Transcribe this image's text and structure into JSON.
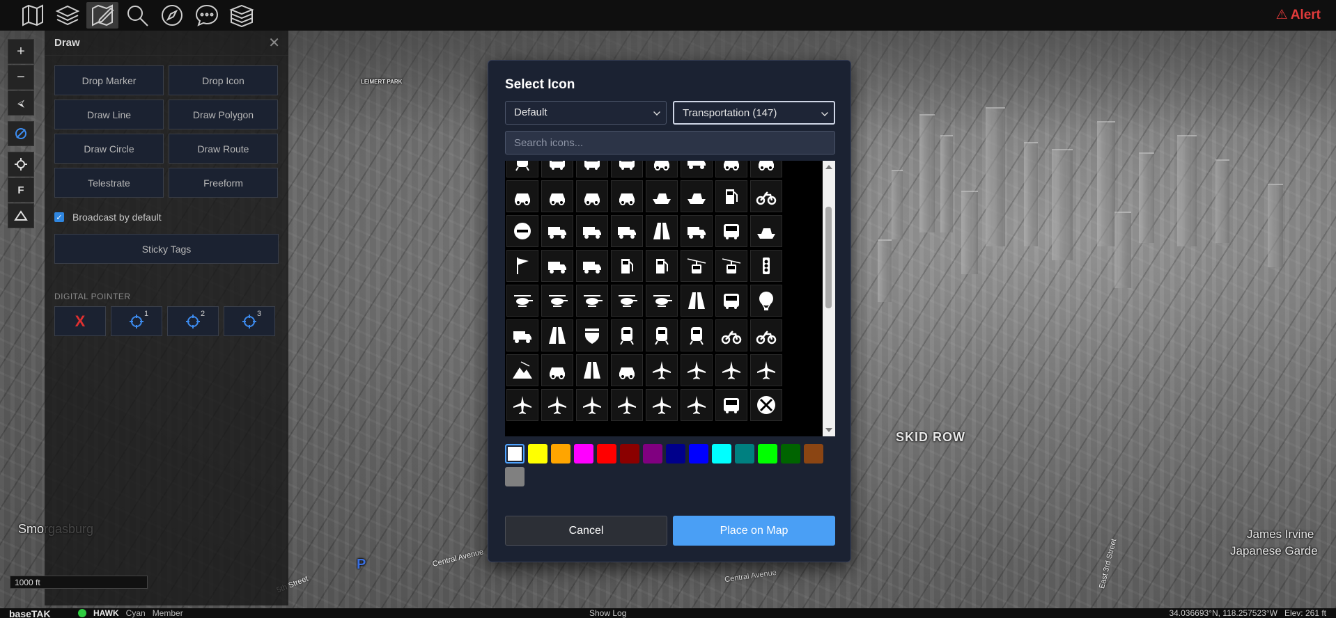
{
  "topbar": {
    "tools": [
      "map-icon",
      "layers-icon",
      "draw-icon",
      "search-icon",
      "compass-icon",
      "chat-icon",
      "data-package-icon"
    ],
    "alert_label": "Alert",
    "alert_color": "#e23b3b"
  },
  "map_controls": [
    "zoom-in",
    "zoom-out",
    "north-arrow",
    "hide-icon",
    "locate-icon",
    "F",
    "terrain-icon"
  ],
  "map_labels": {
    "park": "LEIMERT PARK",
    "skid_row": "SKID ROW",
    "james_irvine": "James Irvine",
    "japanese_garden": "Japanese Garde",
    "smorgasburg": "Smorgasburg",
    "road_1": "Central Avenue",
    "road_2": "Central Avenue",
    "road_3": "5th Street",
    "road_4": "East 3rd Street"
  },
  "draw_panel": {
    "title": "Draw",
    "buttons": [
      "Drop Marker",
      "Drop Icon",
      "Draw Line",
      "Draw Polygon",
      "Draw Circle",
      "Draw Route",
      "Telestrate",
      "Freeform"
    ],
    "broadcast_label": "Broadcast by default",
    "broadcast_checked": true,
    "sticky_tags_label": "Sticky Tags",
    "digital_pointer_title": "DIGITAL POINTER",
    "pointer_buttons": [
      "X",
      "1",
      "2",
      "3"
    ]
  },
  "scale": "1000 ft",
  "status_bar": {
    "brand": "baseTAK",
    "callsign": "HAWK",
    "team": "Cyan",
    "role": "Member",
    "show_log": "Show Log",
    "coords": "34.036693°N, 118.257523°W",
    "elev": "Elev: 261 ft"
  },
  "modal": {
    "title": "Select Icon",
    "iconset_value": "Default",
    "category_value": "Transportation (147)",
    "search_placeholder": "Search icons...",
    "icons": [
      "tram",
      "bus-front",
      "bus",
      "bus-side",
      "limo",
      "truck-front",
      "sedan",
      "suv",
      "car-top",
      "car-front",
      "car-roof-rack",
      "car-crash",
      "ship-wreck",
      "cargo-ship",
      "fuel-attendant",
      "motorcycle",
      "no-entry",
      "factory-truck",
      "dump-truck",
      "mining-truck",
      "road",
      "tractor",
      "camper-front",
      "speedboat",
      "flag",
      "tanker",
      "forklift",
      "gas-pump",
      "ev-charger",
      "gondola",
      "cable-car",
      "traffic-light",
      "helicopter",
      "helicopter-2",
      "helicopter-3",
      "helicopter-4",
      "heliport",
      "highway",
      "rv",
      "hot-air-balloon",
      "tow-truck",
      "road-sign",
      "interstate-shield",
      "locomotive",
      "train-front",
      "metro",
      "scooter",
      "sport-bike",
      "mountain-lift",
      "jeep",
      "offroad",
      "pickup",
      "airplane",
      "airplane-2",
      "airplane-3",
      "small-plane",
      "departing-plane",
      "landing-plane",
      "jet",
      "airport",
      "glider",
      "aircraft-tag",
      "shuttle-bus",
      "railroad-crossing"
    ],
    "colors": [
      "#ffffff",
      "#ffff00",
      "#ffa500",
      "#ff00ff",
      "#ff0000",
      "#8b0000",
      "#800080",
      "#00008b",
      "#0000ff",
      "#00ffff",
      "#008080",
      "#00ff00",
      "#006400",
      "#8b4513",
      "#808080"
    ],
    "selected_color": "#ffffff",
    "cancel_label": "Cancel",
    "place_label": "Place on Map"
  }
}
